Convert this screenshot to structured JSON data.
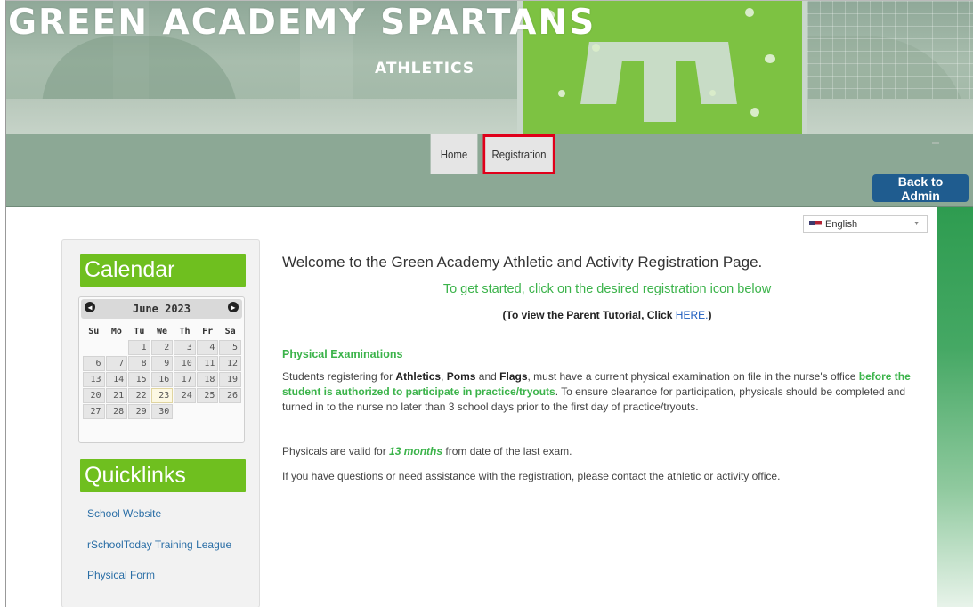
{
  "banner": {
    "title": "GREEN ACADEMY SPARTANS",
    "subtitle": "ATHLETICS"
  },
  "nav": {
    "tabs": [
      {
        "label": "Home"
      },
      {
        "label": "Registration",
        "highlighted": true
      }
    ],
    "back_admin": "Back to Admin"
  },
  "language": {
    "selected": "English",
    "flag": "us-flag-icon"
  },
  "sidebar": {
    "calendar_title": "Calendar",
    "calendar": {
      "month_label": "June 2023",
      "weekdays": [
        "Su",
        "Mo",
        "Tu",
        "We",
        "Th",
        "Fr",
        "Sa"
      ],
      "weeks": [
        [
          "",
          "",
          "",
          "1",
          "2",
          "3",
          "4",
          "5"
        ],
        [
          "6",
          "7",
          "8",
          "9",
          "10",
          "11",
          "12"
        ],
        [
          "13",
          "14",
          "15",
          "16",
          "17",
          "18",
          "19"
        ],
        [
          "20",
          "21",
          "22",
          "23",
          "24",
          "25",
          "26"
        ],
        [
          "27",
          "28",
          "29",
          "30",
          "",
          "",
          ""
        ]
      ],
      "today": "23"
    },
    "quicklinks_title": "Quicklinks",
    "quicklinks": [
      {
        "label": "School Website"
      },
      {
        "label": "rSchoolToday Training League"
      },
      {
        "label": "Physical Form"
      }
    ]
  },
  "main": {
    "welcome": "Welcome to the Green Academy Athletic and Activity Registration Page.",
    "get_started": "To get started, click on the desired registration icon below",
    "tutorial_prefix": "(To view the Parent Tutorial, Click ",
    "tutorial_link": "HERE.",
    "tutorial_suffix": ")",
    "physical_heading": "Physical Examinations",
    "physical_para": {
      "p1": "Students registering for ",
      "athletics": "Athletics",
      "p2": ", ",
      "poms": "Poms",
      "p3": " and ",
      "flags": "Flags",
      "p4": ", must have a current physical examination on file in the nurse's office ",
      "emphasis": "before the student is authorized to participate in practice/tryouts",
      "p5": ".   To ensure clearance for participation, physicals should be completed and turned in to the nurse no later than 3 school days prior to the first day of practice/tryouts."
    },
    "valid": {
      "prefix": "Physicals are valid for ",
      "months": "13 months",
      "suffix": " from date of the last exam."
    },
    "questions": "If you have questions or need assistance with the registration, please contact the athletic or activity office."
  },
  "colors": {
    "accent_green": "#3bb34a",
    "heading_green": "#6fbf1f",
    "admin_blue": "#1f5c8f",
    "highlight_red": "#e0001a"
  }
}
